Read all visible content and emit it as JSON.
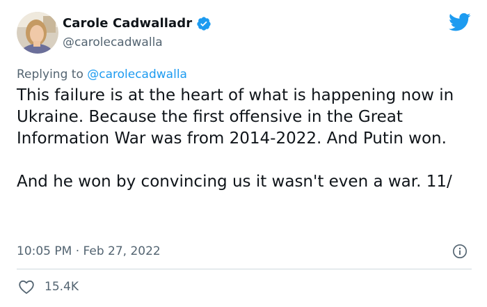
{
  "author": {
    "display_name": "Carole Cadwalladr",
    "handle": "@carolecadwalla",
    "verified": true,
    "avatar_icon": "profile-photo"
  },
  "reply_context": {
    "prefix": "Replying to ",
    "handle": "@carolecadwalla"
  },
  "tweet": {
    "text": "This failure is at the heart of what is happening now in Ukraine. Because the first offensive in the Great Information War was from 2014-2022. And Putin won.\n\nAnd he won by convincing us it wasn't even a war. 11/",
    "time": "10:05 PM",
    "separator": " · ",
    "date": "Feb 27, 2022"
  },
  "engagement": {
    "likes": "15.4K"
  },
  "icons": {
    "brand": "twitter-bird-icon",
    "verified": "verified-badge-icon",
    "info": "info-icon",
    "like": "heart-icon"
  },
  "colors": {
    "brand_blue": "#1d9bf0",
    "text_primary": "#0f1419",
    "text_secondary": "#536471",
    "link": "#1d9bf0",
    "divider": "#cfd9de"
  }
}
